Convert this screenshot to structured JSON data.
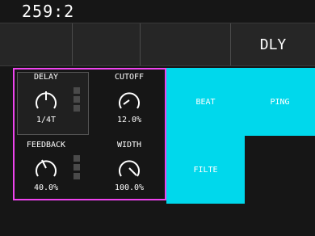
{
  "header": {
    "counter": "259:2"
  },
  "tabs": [
    "",
    "",
    "",
    "DLY"
  ],
  "params": [
    {
      "label": "DELAY",
      "value": "1/4T"
    },
    {
      "label": "CUTOFF",
      "value": "12.0%"
    },
    {
      "label": "FEEDBACK",
      "value": "40.0%"
    },
    {
      "label": "WIDTH",
      "value": "100.0%"
    }
  ],
  "pads": [
    "BEAT",
    "PING",
    "FILTE"
  ],
  "colors": {
    "accent": "#00d8ec",
    "panel_border": "#ee44ee",
    "background": "#161616"
  }
}
